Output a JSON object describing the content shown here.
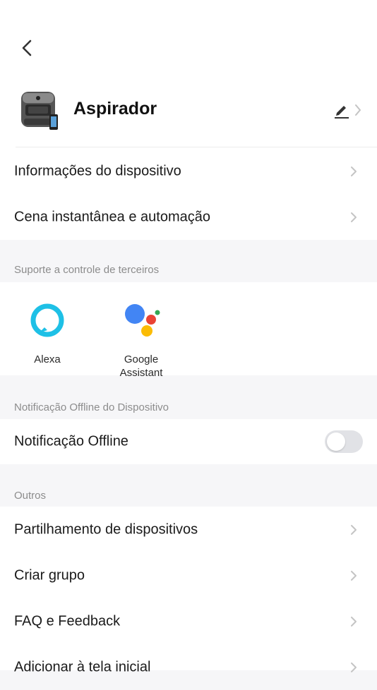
{
  "header": {
    "device_name": "Aspirador"
  },
  "device_section": {
    "items": [
      {
        "label": "Informações do dispositivo"
      },
      {
        "label": "Cena instantânea e automação"
      }
    ]
  },
  "third_party": {
    "title": "Suporte a controle de terceiros",
    "items": [
      {
        "label": "Alexa",
        "icon": "alexa-icon"
      },
      {
        "label": "Google Assistant",
        "icon": "google-assistant-icon"
      }
    ]
  },
  "offline": {
    "title": "Notificação Offline do Dispositivo",
    "label": "Notificação Offline",
    "enabled": false
  },
  "others": {
    "title": "Outros",
    "items": [
      {
        "label": "Partilhamento de dispositivos"
      },
      {
        "label": "Criar grupo"
      },
      {
        "label": "FAQ e Feedback"
      },
      {
        "label": "Adicionar à tela inicial"
      }
    ]
  },
  "colors": {
    "alexa": "#1ec0e6",
    "google_blue": "#4285f4",
    "google_red": "#ea4335",
    "google_yellow": "#fbbc05",
    "google_green": "#34a853",
    "toggle_off": "#e1e2e6"
  }
}
